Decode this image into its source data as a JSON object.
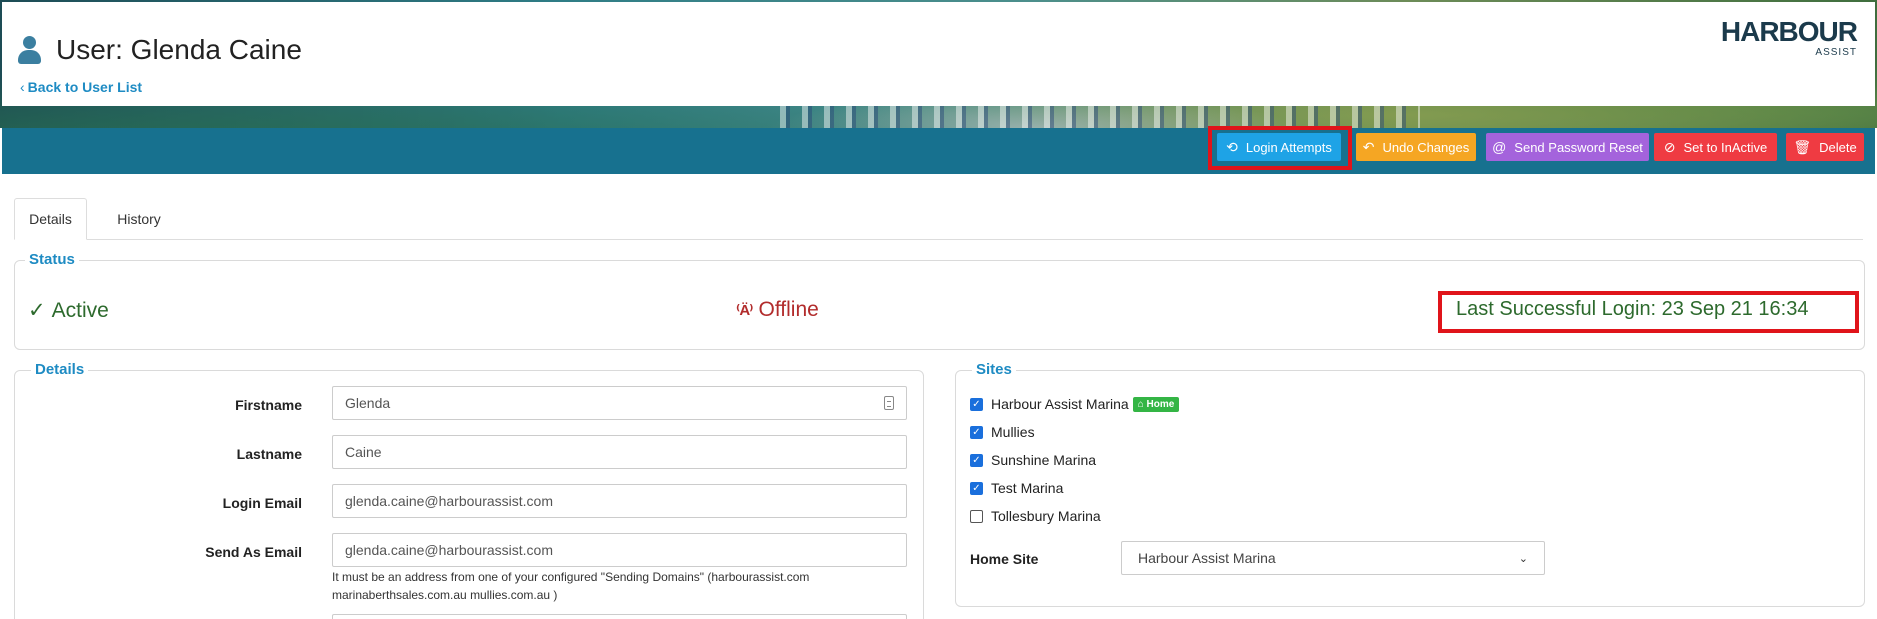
{
  "header": {
    "title": "User: Glenda Caine",
    "back_link": "Back to User List",
    "logo_main": "HARBOUR",
    "logo_sub": "ASSIST"
  },
  "toolbar": {
    "login_attempts": "Login Attempts",
    "undo_changes": "Undo Changes",
    "send_password_reset": "Send Password Reset",
    "set_inactive": "Set to InActive",
    "delete": "Delete"
  },
  "tabs": [
    {
      "label": "Details",
      "active": true
    },
    {
      "label": "History",
      "active": false
    }
  ],
  "status": {
    "legend": "Status",
    "active": "Active",
    "offline": "Offline",
    "last_login": "Last Successful Login: 23 Sep 21 16:34"
  },
  "details": {
    "legend": "Details",
    "firstname_label": "Firstname",
    "firstname_value": "Glenda",
    "lastname_label": "Lastname",
    "lastname_value": "Caine",
    "login_email_label": "Login Email",
    "login_email_value": "glenda.caine@harbourassist.com",
    "send_as_email_label": "Send As Email",
    "send_as_email_value": "glenda.caine@harbourassist.com",
    "help_line1": "It must be an address from one of your configured \"Sending Domains\" (harbourassist.com",
    "help_line2": "marinaberthsales.com.au mullies.com.au )"
  },
  "sites": {
    "legend": "Sites",
    "items": [
      {
        "label": "Harbour Assist Marina",
        "checked": true,
        "home": true
      },
      {
        "label": "Mullies",
        "checked": true
      },
      {
        "label": "Sunshine Marina",
        "checked": true
      },
      {
        "label": "Test Marina",
        "checked": true
      },
      {
        "label": "Tollesbury Marina",
        "checked": false
      }
    ],
    "home_badge": "Home",
    "home_site_label": "Home Site",
    "home_site_value": "Harbour Assist Marina"
  },
  "colors": {
    "action_bar": "#17718f",
    "login_btn": "#1ea3e6",
    "undo_btn": "#f5a623",
    "reset_btn": "#a463dc",
    "danger_btn": "#ef3b42",
    "highlight": "#e0141a"
  }
}
